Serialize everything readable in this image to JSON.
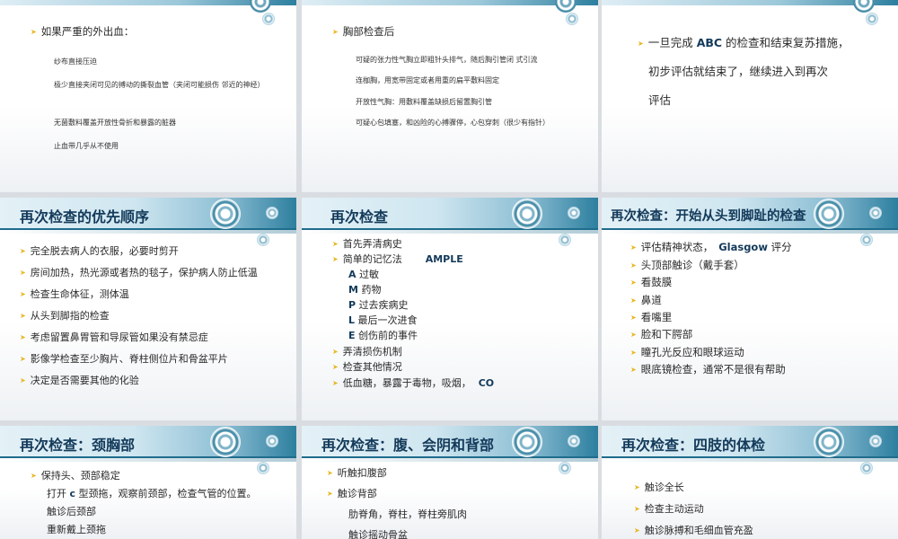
{
  "slides": {
    "s1": {
      "items": [
        "如果严重的外出血：",
        "纱布直接压迫",
        "极少直接夹闭可见的搏动的撕裂血管（夹闭可能损伤 邻近的神经）",
        "无菌敷料覆盖开放性骨折和暴露的脏器",
        "止血带几乎从不使用"
      ]
    },
    "s2": {
      "items": [
        "胸部检查后",
        "可疑的张力性气胸立即粗针头排气，随后胸引管闭 式引流",
        "连枷胸，用宽带固定或者用重的扁平敷料固定",
        "开放性气胸：用敷料覆盖缺损后留置胸引管",
        "可疑心包填塞，和凶险的心搏骤停，心包穿刺（很少有指针）"
      ]
    },
    "s3": {
      "line1_pre": "一旦完成 ",
      "line1_abc": "ABC",
      "line1_post": " 的检查和结束复苏措施，",
      "line2": "初步评估就结束了，继续进入到再次",
      "line3": "评估"
    },
    "s4": {
      "title": "再次检查的优先顺序",
      "items": [
        "完全脱去病人的衣服，必要时剪开",
        "房间加热，热光源或者热的毯子，保护病人防止低温",
        "检查生命体征，测体温",
        "从头到脚指的检查",
        "考虑留置鼻胃管和导尿管如果没有禁忌症",
        "影像学检查至少胸片、脊柱侧位片和骨盆平片",
        "决定是否需要其他的化验"
      ]
    },
    "s5": {
      "title": "再次检查",
      "item1": "首先弄清病史",
      "item2": "简单的记忆法",
      "item2_tag": "AMPLE",
      "mnemonic": [
        {
          "letter": "A",
          "text": "过敏"
        },
        {
          "letter": "M",
          "text": "药物"
        },
        {
          "letter": "P",
          "text": "过去疾病史"
        },
        {
          "letter": "L",
          "text": "最后一次进食"
        },
        {
          "letter": "E",
          "text": "创伤前的事件"
        }
      ],
      "item3": "弄清损伤机制",
      "item4": "检查其他情况",
      "item5": "低血糖，暴露于毒物，吸烟，",
      "item5_tag": "CO"
    },
    "s6": {
      "title": "再次检查：开始从头到脚趾的检查",
      "item1_pre": "评估精神状态，",
      "item1_bold": "Glasgow",
      "item1_post": " 评分",
      "items": [
        "头顶部触诊（戴手套）",
        "看鼓膜",
        "鼻道",
        "看嘴里",
        "脸和下腭部",
        "瞳孔光反应和眼球运动",
        "眼底镜检查，通常不是很有帮助"
      ]
    },
    "s7": {
      "title": "再次检查：颈胸部",
      "item1": "保持头、颈部稳定",
      "sub1_pre": "打开 ",
      "sub1_bold": "c",
      "sub1_post": " 型颈拖，观察前颈部，检查气管的位置。",
      "sub2": "触诊后颈部",
      "sub3": "重新戴上颈拖"
    },
    "s8": {
      "title": "再次检查：腹、会阴和背部",
      "item1": "听触扣腹部",
      "item2": "触诊背部",
      "sub1": "肋脊角，脊柱，脊柱旁肌肉",
      "sub2": "触诊摇动骨盆"
    },
    "s9": {
      "title": "再次检查：四肢的体检",
      "items": [
        "触诊全长",
        "检查主动运动",
        "触诊脉搏和毛细血管充盈"
      ]
    }
  },
  "colors": {
    "bullet": "#e8b620",
    "title": "#133a5a",
    "bar_dark": "#1f6c8c"
  }
}
